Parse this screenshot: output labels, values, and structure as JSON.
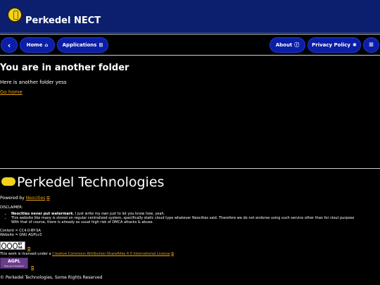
{
  "header": {
    "title": "Perkedel NECT",
    "logo_icon": "perkedel-logo-icon"
  },
  "nav": {
    "back_label": "‹",
    "home_label": "Home",
    "applications_label": "Applications",
    "about_label": "About",
    "privacy_label": "Privacy Policy",
    "menu_label": "≡"
  },
  "main": {
    "heading": "You are in another folder",
    "text": "Here is another folder yess",
    "go_home": "Go home"
  },
  "footer": {
    "title": "Perkedel Technologies",
    "powered_prefix": "Powered by ",
    "powered_link": "Neocities",
    "disclaimer_label": "DISCLAIMER:",
    "disclaimer_1_bold": "Neocities never put watermark",
    "disclaimer_1_rest": ", I just write my own just to let you know how, yeah.",
    "disclaimer_2_line1": "This website like many is stored on regular centralized system, specifically static cloud type whatever Neocities said. Therefore we do not endorse using such service other than for clout purpose",
    "disclaimer_2_line2": "With that of course, there is already as usual high risk of DMCA attacks & abuse.",
    "content_license": "Content = CC4.0-BY-SA",
    "website_license": "Website = GNU AGPLv3",
    "cc_badge_text": "BY SA",
    "license_prefix": "This work is licensed under a ",
    "license_link": "Creative Commons Attribution-ShareAlike 4.0 International License",
    "agpl_text": "AGPL",
    "agpl_sub": "Free as in Freedom",
    "copyright": "© Perkedel Technologies, Some Rights Reserved"
  },
  "colors": {
    "header_bg": "#0b1f6e",
    "pill_bg": "#0b1ea6",
    "link": "#e8a317",
    "logo": "#f2d21b"
  }
}
